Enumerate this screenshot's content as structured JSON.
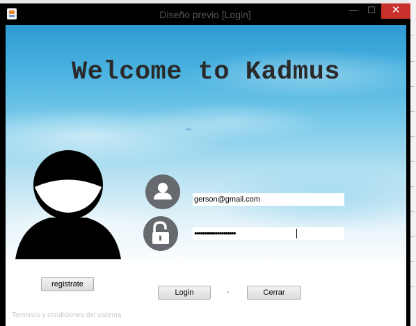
{
  "window": {
    "title": "Diseño previo [Login]",
    "controls": {
      "minimize": "—",
      "maximize": "☐",
      "close": "✕"
    }
  },
  "header": {
    "welcome": "Welcome to Kadmus"
  },
  "form": {
    "email_value": "gerson@gmail.com",
    "password_value": "••••••••••••••••••••"
  },
  "buttons": {
    "register": "registrate",
    "login": "Login",
    "separator": ".",
    "close": "Cerrar"
  },
  "footer": {
    "terms": "Terminos y condiciones del sistema"
  },
  "icons": {
    "avatar": "user-avatar-icon",
    "user": "user-icon",
    "lock": "unlocked-padlock-icon"
  },
  "colors": {
    "title_bar": "#000000",
    "close_button": "#c7302b",
    "sky_top": "#2f9ad2",
    "icon_circle": "#666a6e"
  }
}
